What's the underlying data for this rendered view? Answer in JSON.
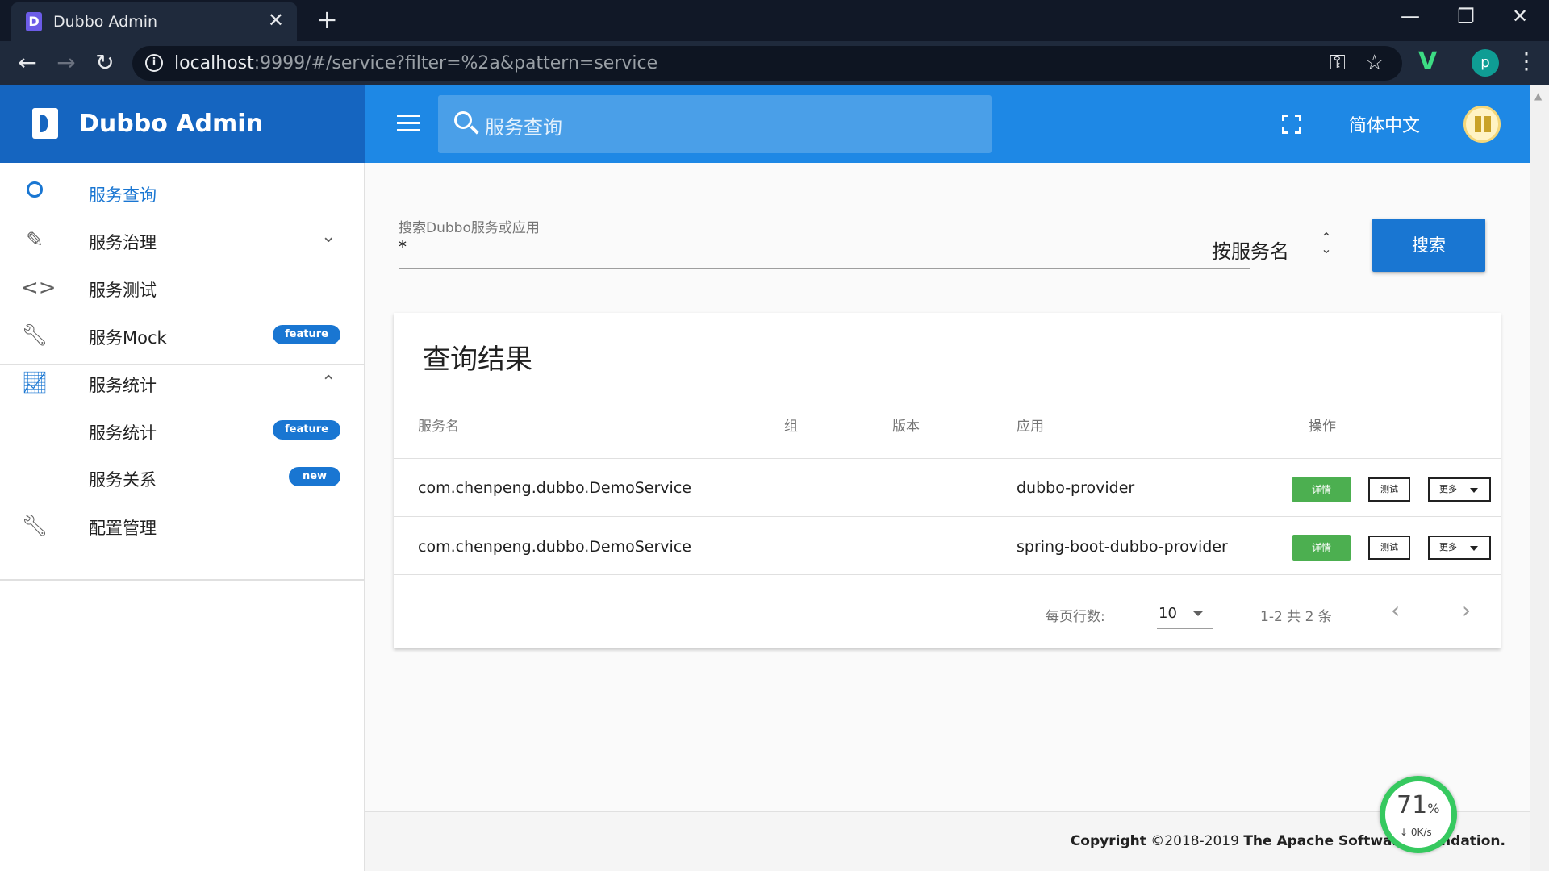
{
  "browser": {
    "tab_title": "Dubbo Admin",
    "tab_favicon": "D",
    "url_host": "localhost",
    "url_rest": ":9999/#/service?filter=%2a&pattern=service",
    "profile_initial": "p"
  },
  "header": {
    "app_title": "Dubbo Admin",
    "search_placeholder": "服务查询",
    "language": "简体中文"
  },
  "sidebar": {
    "items": [
      {
        "label": "服务查询"
      },
      {
        "label": "服务治理"
      },
      {
        "label": "服务测试"
      },
      {
        "label": "服务Mock",
        "badge": "feature"
      },
      {
        "label": "服务统计"
      },
      {
        "label": "服务统计",
        "badge": "feature"
      },
      {
        "label": "服务关系",
        "badge": "new"
      },
      {
        "label": "配置管理"
      }
    ]
  },
  "search": {
    "label": "搜索Dubbo服务或应用",
    "value": "*",
    "pattern": "按服务名",
    "button": "搜索"
  },
  "results": {
    "title": "查询结果",
    "columns": [
      "服务名",
      "组",
      "版本",
      "应用",
      "操作"
    ],
    "rows": [
      {
        "service": "com.chenpeng.dubbo.DemoService",
        "group": "",
        "version": "",
        "app": "dubbo-provider"
      },
      {
        "service": "com.chenpeng.dubbo.DemoService",
        "group": "",
        "version": "",
        "app": "spring-boot-dubbo-provider"
      }
    ],
    "actions": {
      "detail": "详情",
      "test": "测试",
      "more": "更多"
    },
    "pager": {
      "rows_label": "每页行数:",
      "rows_value": "10",
      "range": "1-2 共 2 条"
    }
  },
  "footer": {
    "prefix": "Copyright",
    "years": " ©2018-2019 ",
    "org": "The Apache Software Foundation."
  },
  "speed_widget": {
    "percent": "71",
    "unit": "%",
    "rate": "0K/s"
  },
  "colors": {
    "primary_dark": "#1565c0",
    "primary": "#1e88e5",
    "accent": "#1976d2",
    "success": "#4caf50"
  }
}
